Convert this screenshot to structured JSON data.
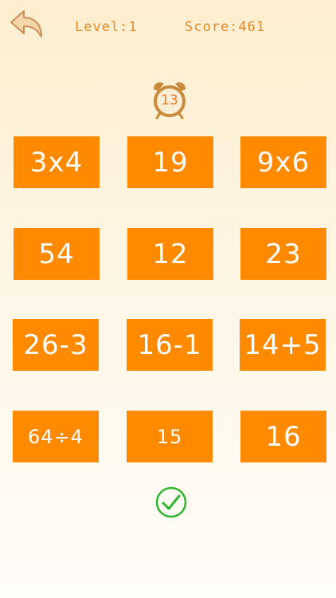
{
  "header": {
    "back_icon": "back-arrow-icon",
    "level": "Level:1",
    "score": "Score:461"
  },
  "timer": {
    "icon": "alarm-clock-icon",
    "value": "13"
  },
  "tiles": [
    [
      "3x4",
      "19",
      "9x6"
    ],
    [
      "54",
      "12",
      "23"
    ],
    [
      "26-3",
      "16-1",
      "14+5"
    ],
    [
      "64÷4",
      "15",
      "16"
    ]
  ],
  "confirm": {
    "icon": "checkmark-circle-icon"
  },
  "colors": {
    "tile": "#ff8a00",
    "hud_text": "#e8892a",
    "check": "#2fb52f"
  }
}
